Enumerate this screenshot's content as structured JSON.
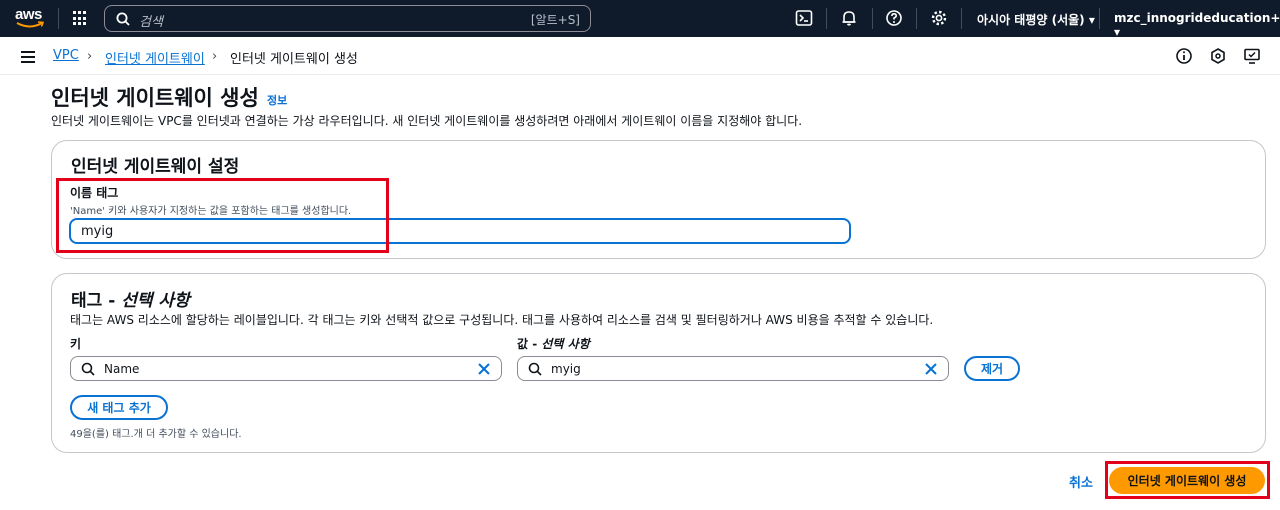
{
  "topbar": {
    "logo_text": "aws",
    "search_placeholder": "검색",
    "search_shortcut": "[알트+S]",
    "icons": [
      "services-grid-icon",
      "cloudshell-icon",
      "bell-icon",
      "help-icon",
      "gear-icon"
    ],
    "region": "아시아 태평양 (서울) ▾",
    "account": "mzc_innogrideducation+41 ▾"
  },
  "breadcrumb": {
    "items": [
      "VPC",
      "인터넷 게이트웨이",
      "인터넷 게이트웨이 생성"
    ],
    "separator": "›"
  },
  "page": {
    "title": "인터넷 게이트웨이 생성",
    "info_link": "정보",
    "description": "인터넷 게이트웨이는 VPC를 인터넷과 연결하는 가상 라우터입니다. 새 인터넷 게이트웨이를 생성하려면 아래에서 게이트웨이 이름을 지정해야 합니다."
  },
  "settings_panel": {
    "title": "인터넷 게이트웨이 설정",
    "name_tag_label": "이름 태그",
    "name_tag_desc": "'Name' 키와 사용자가 지정하는 값을 포함하는 태그를 생성합니다.",
    "name_tag_value": "myig"
  },
  "tags_panel": {
    "title_prefix": "태그 - ",
    "title_optional": "선택 사항",
    "description": "태그는 AWS 리소스에 할당하는 레이블입니다. 각 태그는 키와 선택적 값으로 구성됩니다. 태그를 사용하여 리소스를 검색 및 필터링하거나 AWS 비용을 추적할 수 있습니다.",
    "key_label": "키",
    "value_label_prefix": "값 - ",
    "value_label_optional": "선택 사항",
    "key_value": "Name",
    "value_value": "myig",
    "remove_button": "제거",
    "add_tag_button": "새 태그 추가",
    "remaining_hint": "49을(를) 태그.개 더 추가할 수 있습니다."
  },
  "footer": {
    "cancel": "취소",
    "submit": "인터넷 게이트웨이 생성"
  },
  "colors": {
    "topbar_bg": "#0f1b2a",
    "link": "#0972d3",
    "primary": "#ff9900",
    "highlight": "#e3001b"
  }
}
